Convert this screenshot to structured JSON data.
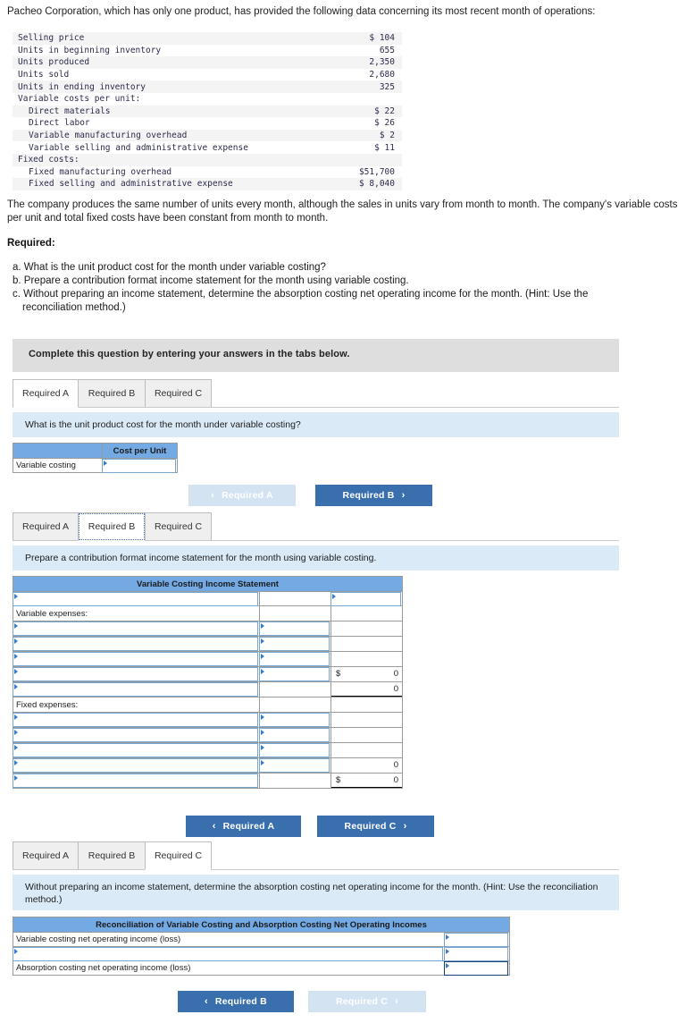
{
  "intro": {
    "paragraph1": "Pacheo Corporation, which has only one product, has provided the following data concerning its most recent month of operations:",
    "paragraph2": "The company produces the same number of units every month, although the sales in units vary from month to month. The company's variable costs per unit and total fixed costs have been constant from month to month."
  },
  "data_table": {
    "rows": [
      {
        "label": "Selling price",
        "value": "$ 104",
        "indent": 0,
        "shade": true
      },
      {
        "label": "Units in beginning inventory",
        "value": "655",
        "indent": 0,
        "shade": false
      },
      {
        "label": "Units produced",
        "value": "2,350",
        "indent": 0,
        "shade": true
      },
      {
        "label": "Units sold",
        "value": "2,680",
        "indent": 0,
        "shade": false
      },
      {
        "label": "Units in ending inventory",
        "value": "325",
        "indent": 0,
        "shade": true
      },
      {
        "label": "Variable costs per unit:",
        "value": "",
        "indent": 0,
        "shade": false
      },
      {
        "label": "Direct materials",
        "value": "$ 22",
        "indent": 1,
        "shade": true
      },
      {
        "label": "Direct labor",
        "value": "$ 26",
        "indent": 1,
        "shade": false
      },
      {
        "label": "Variable manufacturing overhead",
        "value": "$ 2",
        "indent": 1,
        "shade": true
      },
      {
        "label": "Variable selling and administrative expense",
        "value": "$ 11",
        "indent": 1,
        "shade": false
      },
      {
        "label": "Fixed costs:",
        "value": "",
        "indent": 0,
        "shade": true
      },
      {
        "label": "Fixed manufacturing overhead",
        "value": "$51,700",
        "indent": 1,
        "shade": false
      },
      {
        "label": "Fixed selling and administrative expense",
        "value": "$ 8,040",
        "indent": 1,
        "shade": true
      }
    ]
  },
  "required": {
    "heading": "Required:",
    "items": [
      {
        "marker": "a.",
        "text": "What is the unit product cost for the month under variable costing?"
      },
      {
        "marker": "b.",
        "text": "Prepare a contribution format income statement for the month using variable costing."
      },
      {
        "marker": "c.",
        "text": "Without preparing an income statement, determine the absorption costing net operating income for the month. (Hint: Use the",
        "continuation": "reconciliation method.)"
      }
    ]
  },
  "banner": {
    "text": "Complete this question by entering your answers in the tabs below."
  },
  "tabs": {
    "labels": [
      "Required A",
      "Required B",
      "Required C"
    ]
  },
  "section_a": {
    "question": "What is the unit product cost for the month under variable costing?",
    "table": {
      "header_blank": "",
      "header_cost": "Cost per Unit",
      "row_label": "Variable costing",
      "row_value": ""
    },
    "nav": {
      "prev_label": "Required A",
      "prev_disabled": true,
      "next_label": "Required B",
      "next_disabled": false
    }
  },
  "section_b": {
    "question": "Prepare a contribution format income statement for the month using variable costing.",
    "table": {
      "title": "Variable Costing Income Statement",
      "rows": [
        {
          "label": "",
          "label_input": true,
          "mid": "",
          "mid_input": false,
          "right": "",
          "right_input": true,
          "right_cur": "",
          "right_num": ""
        },
        {
          "label": "Variable expenses:",
          "label_input": false,
          "mid": "",
          "mid_input": false,
          "right": "",
          "right_input": false,
          "right_cur": "",
          "right_num": ""
        },
        {
          "label": "",
          "label_input": true,
          "mid": "",
          "mid_input": true,
          "right": "",
          "right_input": false,
          "right_cur": "",
          "right_num": ""
        },
        {
          "label": "",
          "label_input": true,
          "mid": "",
          "mid_input": true,
          "right": "",
          "right_input": false,
          "right_cur": "",
          "right_num": ""
        },
        {
          "label": "",
          "label_input": true,
          "mid": "",
          "mid_input": true,
          "right": "",
          "right_input": false,
          "right_cur": "",
          "right_num": ""
        },
        {
          "label": "",
          "label_input": true,
          "mid": "",
          "mid_input": true,
          "right": "",
          "right_input": false,
          "right_cur": "$",
          "right_num": "0"
        },
        {
          "label": "",
          "label_input": true,
          "mid": "",
          "mid_input": false,
          "right": "",
          "right_input": false,
          "right_cur": "",
          "right_num": "0",
          "right_botline": true
        },
        {
          "label": "Fixed expenses:",
          "label_input": false,
          "mid": "",
          "mid_input": false,
          "right": "",
          "right_input": false,
          "right_cur": "",
          "right_num": ""
        },
        {
          "label": "",
          "label_input": true,
          "mid": "",
          "mid_input": true,
          "right": "",
          "right_input": false,
          "right_cur": "",
          "right_num": ""
        },
        {
          "label": "",
          "label_input": true,
          "mid": "",
          "mid_input": true,
          "right": "",
          "right_input": false,
          "right_cur": "",
          "right_num": ""
        },
        {
          "label": "",
          "label_input": true,
          "mid": "",
          "mid_input": true,
          "right": "",
          "right_input": false,
          "right_cur": "",
          "right_num": ""
        },
        {
          "label": "",
          "label_input": true,
          "mid": "",
          "mid_input": true,
          "right": "",
          "right_input": false,
          "right_cur": "",
          "right_num": "0"
        },
        {
          "label": "",
          "label_input": true,
          "mid": "",
          "mid_input": false,
          "right": "",
          "right_input": false,
          "right_cur": "$",
          "right_num": "0",
          "right_botline": true
        }
      ]
    },
    "nav": {
      "prev_label": "Required A",
      "prev_disabled": false,
      "next_label": "Required C",
      "next_disabled": false
    }
  },
  "section_c": {
    "question": "Without preparing an income statement, determine the absorption costing net operating income for the month. (Hint: Use the reconciliation method.)",
    "table": {
      "title": "Reconciliation of Variable Costing and Absorption Costing Net Operating Incomes",
      "rows": [
        {
          "label": "Variable costing net operating income (loss)",
          "label_input": false,
          "value": "",
          "value_focus": false
        },
        {
          "label": "",
          "label_input": true,
          "value": "",
          "value_focus": false
        },
        {
          "label": "Absorption costing net operating income (loss)",
          "label_input": false,
          "value": "",
          "value_focus": true
        }
      ]
    },
    "nav": {
      "prev_label": "Required B",
      "prev_disabled": false,
      "next_label": "Required C",
      "next_disabled": true
    }
  },
  "icons": {
    "chevron_left": "‹",
    "chevron_right": "›"
  }
}
